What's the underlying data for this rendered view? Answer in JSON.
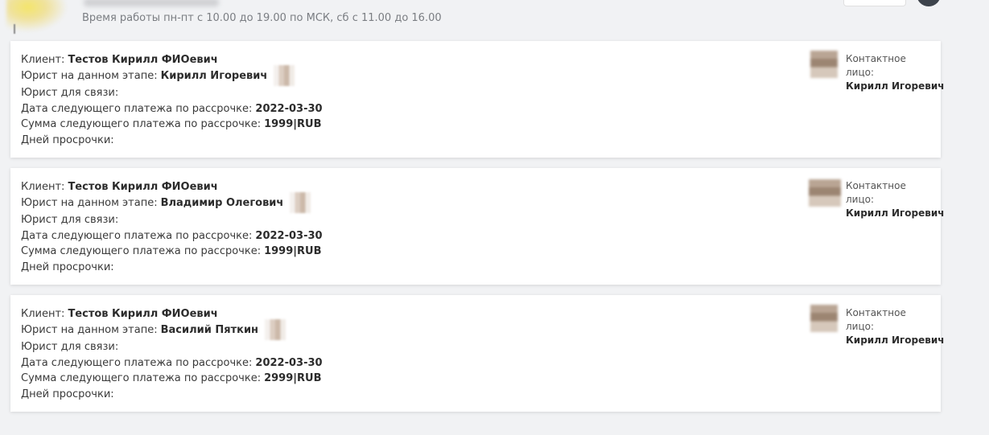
{
  "header": {
    "work_hours": "Время работы пн-пт с 10.00 до 19.00 по МСК, сб с 11.00 до 16.00"
  },
  "labels": {
    "client": "Клиент:",
    "lawyer_stage": "Юрист на данном этапе:",
    "lawyer_contact": "Юрист для связи:",
    "next_payment_date": "Дата следующего платежа по рассрочке:",
    "next_payment_sum": "Сумма следующего платежа по рассрочке:",
    "overdue_days": "Дней просрочки:",
    "contact_person": "Контактное лицо:"
  },
  "cards": [
    {
      "client": "Тестов Кирилл ФИОевич",
      "lawyer_stage": "Кирилл Игоревич",
      "lawyer_contact": "",
      "next_payment_date": "2022-03-30",
      "next_payment_sum": "1999|RUB",
      "overdue_days": "",
      "contact_person": "Кирилл Игоревич"
    },
    {
      "client": "Тестов Кирилл ФИОевич",
      "lawyer_stage": "Владимир Олегович",
      "lawyer_contact": "",
      "next_payment_date": "2022-03-30",
      "next_payment_sum": "1999|RUB",
      "overdue_days": "",
      "contact_person": "Кирилл Игоревич"
    },
    {
      "client": "Тестов Кирилл ФИОевич",
      "lawyer_stage": "Василий Пяткин",
      "lawyer_contact": "",
      "next_payment_date": "2022-03-30",
      "next_payment_sum": "2999|RUB",
      "overdue_days": "",
      "contact_person": "Кирилл Игоревич"
    }
  ]
}
